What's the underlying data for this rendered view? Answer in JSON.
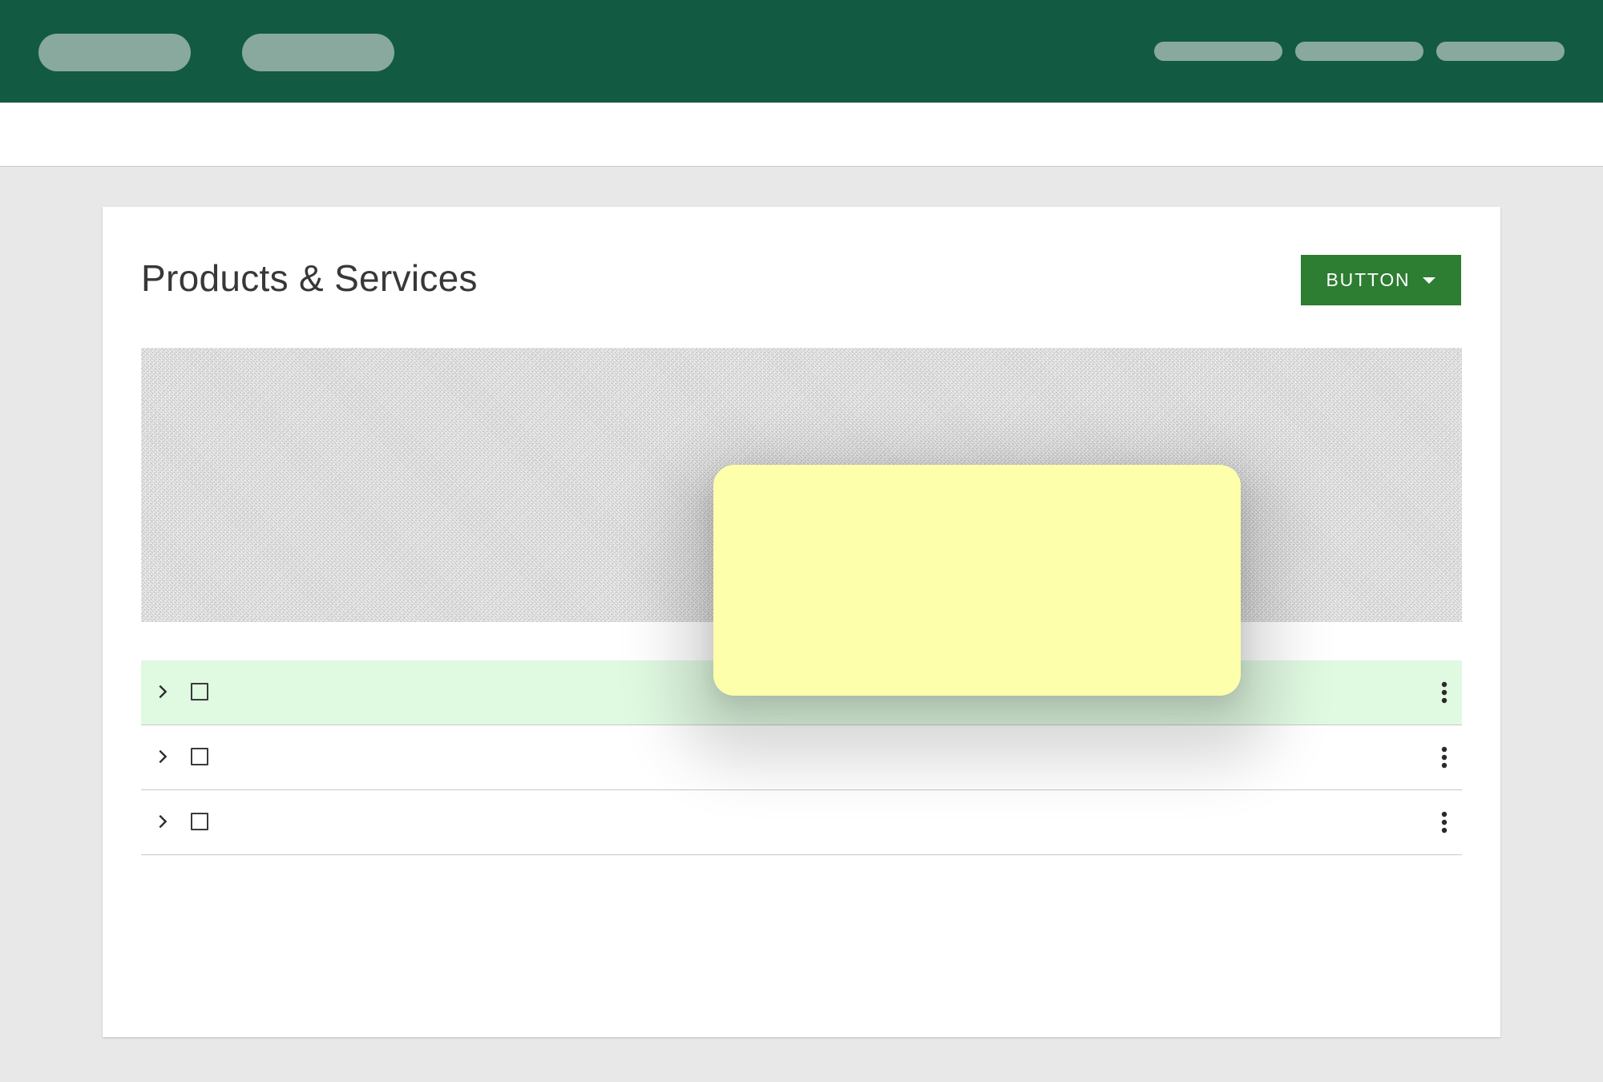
{
  "topbar": {
    "bg_color": "#135a43",
    "left_nav": [
      "",
      ""
    ],
    "right_nav": [
      "",
      "",
      ""
    ]
  },
  "card": {
    "title": "Products & Services",
    "button_label": "BUTTON",
    "button_color": "#2d7d32"
  },
  "table": {
    "rows": [
      {
        "selected": true
      },
      {
        "selected": false
      },
      {
        "selected": false
      }
    ],
    "selected_row_color": "#e0f9e1"
  },
  "note": {
    "color": "#feffab"
  }
}
